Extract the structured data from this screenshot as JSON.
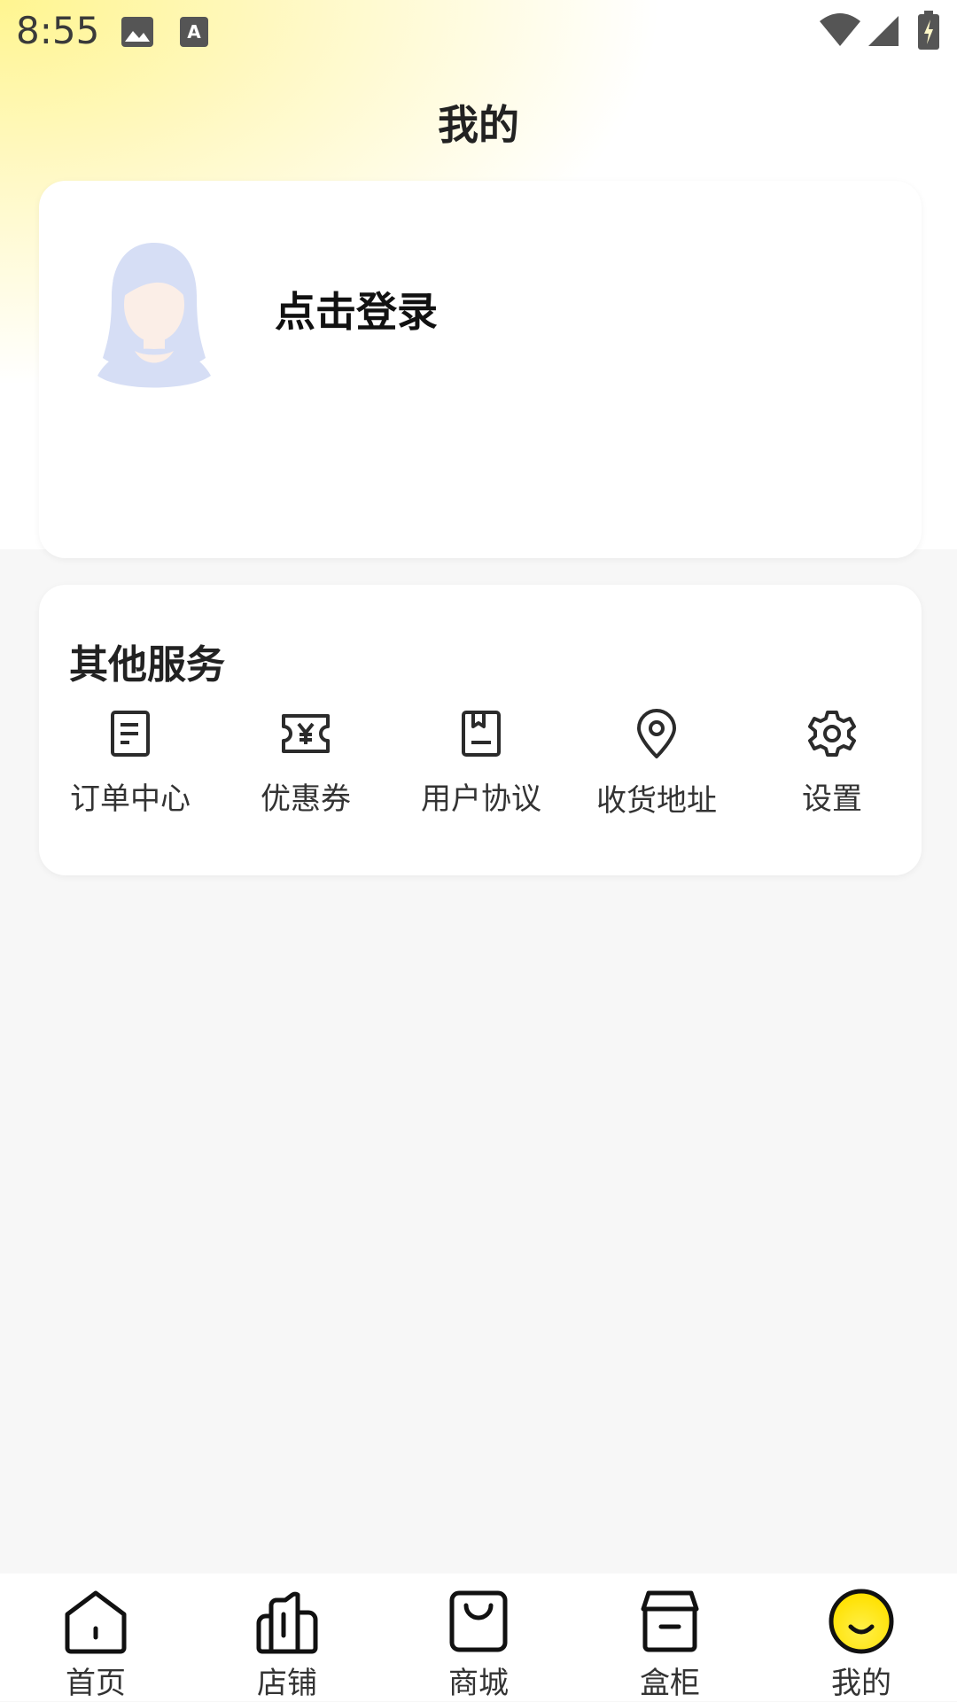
{
  "status_bar": {
    "time": "8:55",
    "left_icons": [
      "image-icon",
      "font-download-icon"
    ],
    "right_icons": [
      "wifi-icon",
      "signal-icon",
      "battery-charging-icon"
    ]
  },
  "header": {
    "title": "我的"
  },
  "login_card": {
    "login_text": "点击登录",
    "avatar_icon": "user-avatar-icon"
  },
  "services": {
    "title": "其他服务",
    "items": [
      {
        "label": "订单中心",
        "icon": "order-doc-icon"
      },
      {
        "label": "优惠券",
        "icon": "coupon-icon"
      },
      {
        "label": "用户协议",
        "icon": "agreement-icon"
      },
      {
        "label": "收货地址",
        "icon": "location-pin-icon"
      },
      {
        "label": "设置",
        "icon": "gear-icon"
      }
    ]
  },
  "tab_bar": {
    "items": [
      {
        "label": "首页",
        "icon": "home-icon",
        "active": false
      },
      {
        "label": "店铺",
        "icon": "store-icon",
        "active": false
      },
      {
        "label": "商城",
        "icon": "shopping-bag-icon",
        "active": false
      },
      {
        "label": "盒柜",
        "icon": "box-cabinet-icon",
        "active": false
      },
      {
        "label": "我的",
        "icon": "smiley-icon",
        "active": true
      }
    ]
  },
  "colors": {
    "accent_yellow": "#ffe600",
    "icon_dark": "#2b2b2b",
    "avatar_blue": "#d6def5"
  }
}
